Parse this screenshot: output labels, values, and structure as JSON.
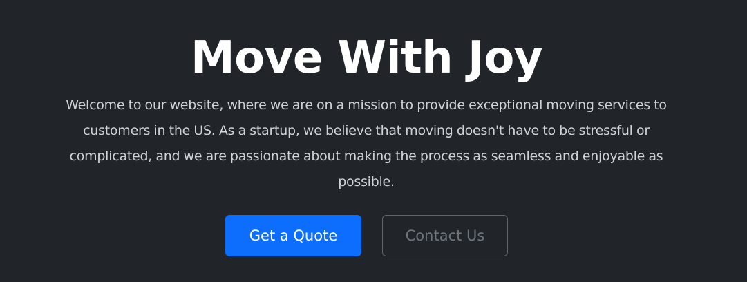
{
  "hero": {
    "title": "Move With Joy",
    "lead": "Welcome to our website, where we are on a mission to provide exceptional moving services to customers in the US. As a startup, we believe that moving doesn't have to be stressful or complicated, and we are passionate about making the process as seamless and enjoyable as possible.",
    "primary_button_label": "Get a Quote",
    "secondary_button_label": "Contact Us"
  },
  "colors": {
    "background": "#212529",
    "title": "#ffffff",
    "lead_text": "#ced4da",
    "primary_button": "#0d6efd",
    "secondary_button_text": "#6c757d",
    "secondary_button_border": "#5f666d"
  }
}
